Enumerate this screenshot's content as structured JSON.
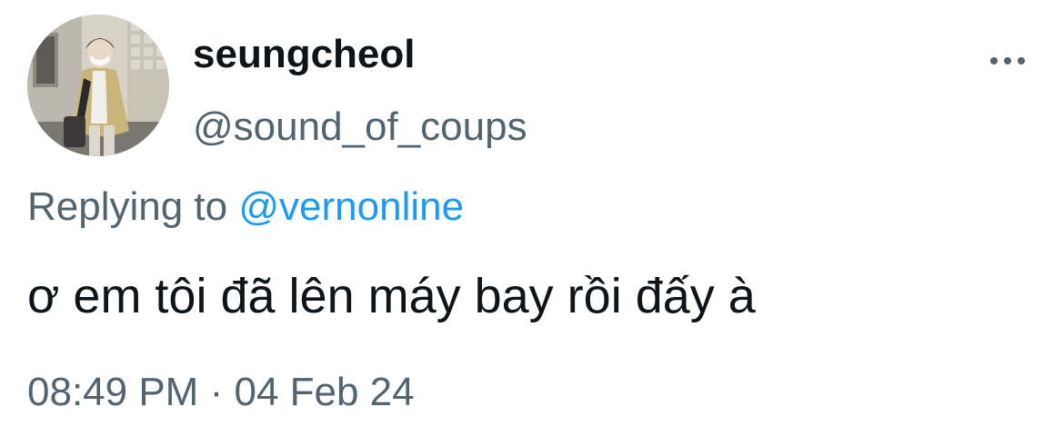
{
  "author": {
    "display_name": "seungcheol",
    "handle": "@sound_of_coups",
    "avatar_icon": "profile-photo"
  },
  "menu": {
    "icon": "more-horizontal-icon"
  },
  "reply": {
    "prefix": "Replying to",
    "mention": "@vernonline"
  },
  "tweet": {
    "text": "ơ em tôi đã lên máy bay rồi đấy à"
  },
  "meta": {
    "time": "08:49 PM",
    "separator": "·",
    "date": "04 Feb 24"
  },
  "colors": {
    "text_primary": "#0f1419",
    "text_secondary": "#536471",
    "link": "#1d9bf0",
    "background": "#ffffff"
  }
}
